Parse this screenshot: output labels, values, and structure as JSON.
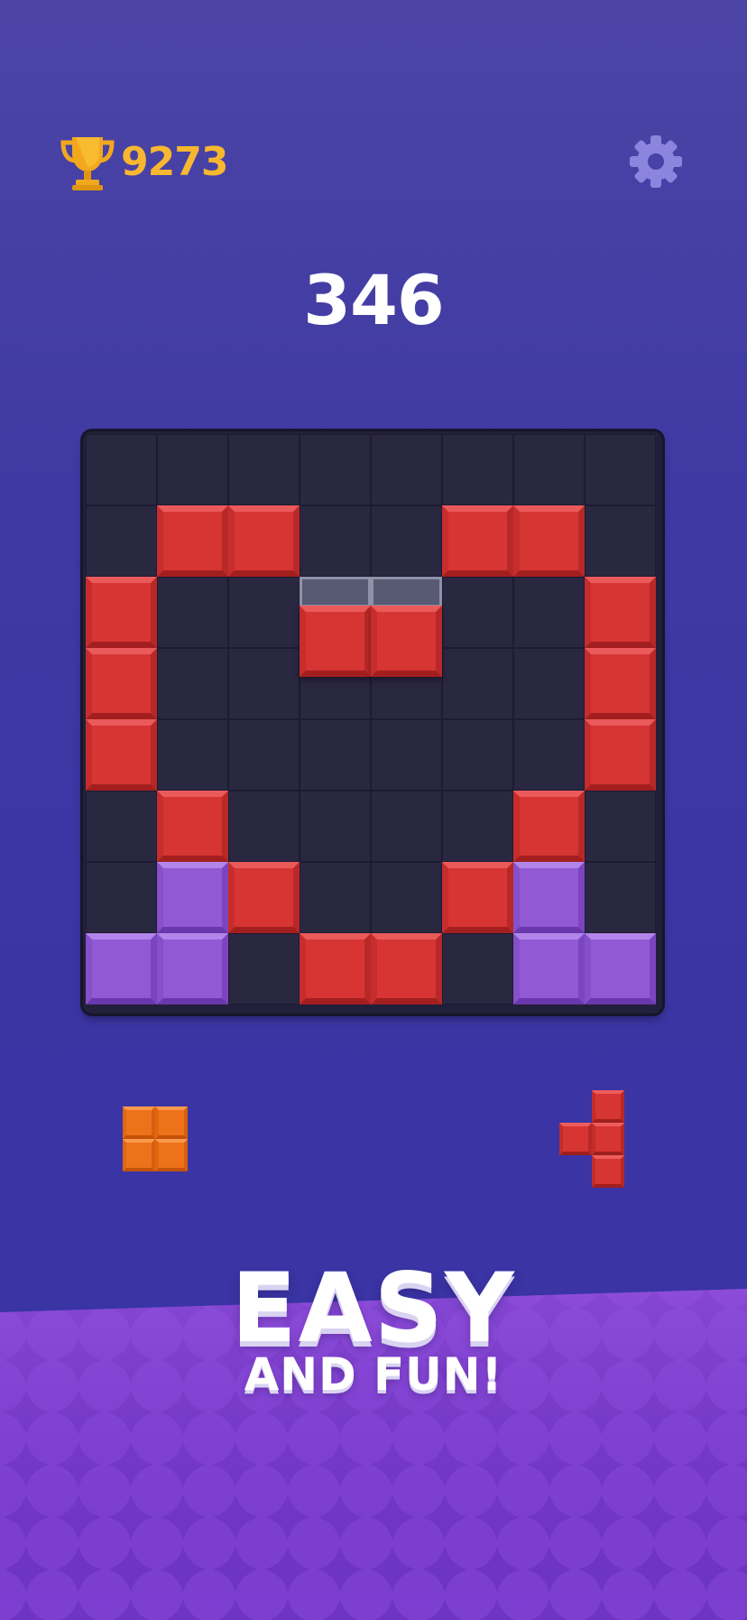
{
  "header": {
    "best_score": "9273",
    "trophy_icon": "trophy-icon",
    "settings_icon": "gear-icon"
  },
  "score": "346",
  "board": {
    "rows": 8,
    "cols": 8,
    "cells": [
      [
        "",
        "",
        "",
        "",
        "",
        "",
        "",
        ""
      ],
      [
        "",
        "red",
        "red",
        "",
        "",
        "red",
        "red",
        ""
      ],
      [
        "red",
        "",
        "",
        "",
        "",
        "",
        "",
        "red"
      ],
      [
        "red",
        "",
        "",
        "",
        "",
        "",
        "",
        "red"
      ],
      [
        "red",
        "",
        "",
        "",
        "",
        "",
        "",
        "red"
      ],
      [
        "",
        "red",
        "",
        "",
        "",
        "",
        "red",
        ""
      ],
      [
        "",
        "purple",
        "red",
        "",
        "",
        "red",
        "purple",
        ""
      ],
      [
        "purple",
        "purple",
        "",
        "red",
        "red",
        "",
        "purple",
        "purple"
      ]
    ],
    "dragging_piece": {
      "color": "red",
      "cells": [
        [
          2,
          3
        ],
        [
          2,
          4
        ]
      ]
    }
  },
  "tray": [
    {
      "name": "orange-square-piece",
      "color": "orange",
      "cells": [
        [
          0,
          0
        ],
        [
          0,
          1
        ],
        [
          1,
          0
        ],
        [
          1,
          1
        ]
      ]
    },
    {
      "name": "red-t-piece",
      "color": "red",
      "cells": [
        [
          0,
          1
        ],
        [
          1,
          0
        ],
        [
          1,
          1
        ],
        [
          2,
          1
        ]
      ]
    }
  ],
  "banner": {
    "title": "EASY",
    "subtitle": "AND FUN!"
  },
  "colors": {
    "background": "#3f3aa3",
    "board": "#221f3a",
    "red_block": "#d73434",
    "purple_block": "#9259d4",
    "orange_block": "#ee7219",
    "gold_text": "#f7b731",
    "banner_purple": "#7c3fcf"
  }
}
